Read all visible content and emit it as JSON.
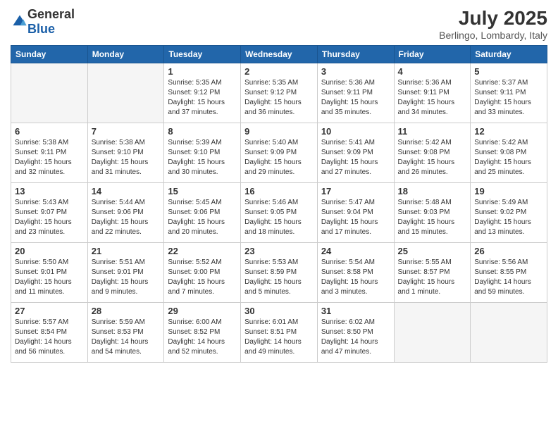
{
  "logo": {
    "general": "General",
    "blue": "Blue"
  },
  "title": {
    "month": "July 2025",
    "location": "Berlingo, Lombardy, Italy"
  },
  "weekdays": [
    "Sunday",
    "Monday",
    "Tuesday",
    "Wednesday",
    "Thursday",
    "Friday",
    "Saturday"
  ],
  "weeks": [
    [
      {
        "day": "",
        "empty": true
      },
      {
        "day": "",
        "empty": true
      },
      {
        "day": "1",
        "sunrise": "5:35 AM",
        "sunset": "9:12 PM",
        "daylight": "15 hours and 37 minutes."
      },
      {
        "day": "2",
        "sunrise": "5:35 AM",
        "sunset": "9:12 PM",
        "daylight": "15 hours and 36 minutes."
      },
      {
        "day": "3",
        "sunrise": "5:36 AM",
        "sunset": "9:11 PM",
        "daylight": "15 hours and 35 minutes."
      },
      {
        "day": "4",
        "sunrise": "5:36 AM",
        "sunset": "9:11 PM",
        "daylight": "15 hours and 34 minutes."
      },
      {
        "day": "5",
        "sunrise": "5:37 AM",
        "sunset": "9:11 PM",
        "daylight": "15 hours and 33 minutes."
      }
    ],
    [
      {
        "day": "6",
        "sunrise": "5:38 AM",
        "sunset": "9:11 PM",
        "daylight": "15 hours and 32 minutes."
      },
      {
        "day": "7",
        "sunrise": "5:38 AM",
        "sunset": "9:10 PM",
        "daylight": "15 hours and 31 minutes."
      },
      {
        "day": "8",
        "sunrise": "5:39 AM",
        "sunset": "9:10 PM",
        "daylight": "15 hours and 30 minutes."
      },
      {
        "day": "9",
        "sunrise": "5:40 AM",
        "sunset": "9:09 PM",
        "daylight": "15 hours and 29 minutes."
      },
      {
        "day": "10",
        "sunrise": "5:41 AM",
        "sunset": "9:09 PM",
        "daylight": "15 hours and 27 minutes."
      },
      {
        "day": "11",
        "sunrise": "5:42 AM",
        "sunset": "9:08 PM",
        "daylight": "15 hours and 26 minutes."
      },
      {
        "day": "12",
        "sunrise": "5:42 AM",
        "sunset": "9:08 PM",
        "daylight": "15 hours and 25 minutes."
      }
    ],
    [
      {
        "day": "13",
        "sunrise": "5:43 AM",
        "sunset": "9:07 PM",
        "daylight": "15 hours and 23 minutes."
      },
      {
        "day": "14",
        "sunrise": "5:44 AM",
        "sunset": "9:06 PM",
        "daylight": "15 hours and 22 minutes."
      },
      {
        "day": "15",
        "sunrise": "5:45 AM",
        "sunset": "9:06 PM",
        "daylight": "15 hours and 20 minutes."
      },
      {
        "day": "16",
        "sunrise": "5:46 AM",
        "sunset": "9:05 PM",
        "daylight": "15 hours and 18 minutes."
      },
      {
        "day": "17",
        "sunrise": "5:47 AM",
        "sunset": "9:04 PM",
        "daylight": "15 hours and 17 minutes."
      },
      {
        "day": "18",
        "sunrise": "5:48 AM",
        "sunset": "9:03 PM",
        "daylight": "15 hours and 15 minutes."
      },
      {
        "day": "19",
        "sunrise": "5:49 AM",
        "sunset": "9:02 PM",
        "daylight": "15 hours and 13 minutes."
      }
    ],
    [
      {
        "day": "20",
        "sunrise": "5:50 AM",
        "sunset": "9:01 PM",
        "daylight": "15 hours and 11 minutes."
      },
      {
        "day": "21",
        "sunrise": "5:51 AM",
        "sunset": "9:01 PM",
        "daylight": "15 hours and 9 minutes."
      },
      {
        "day": "22",
        "sunrise": "5:52 AM",
        "sunset": "9:00 PM",
        "daylight": "15 hours and 7 minutes."
      },
      {
        "day": "23",
        "sunrise": "5:53 AM",
        "sunset": "8:59 PM",
        "daylight": "15 hours and 5 minutes."
      },
      {
        "day": "24",
        "sunrise": "5:54 AM",
        "sunset": "8:58 PM",
        "daylight": "15 hours and 3 minutes."
      },
      {
        "day": "25",
        "sunrise": "5:55 AM",
        "sunset": "8:57 PM",
        "daylight": "15 hours and 1 minute."
      },
      {
        "day": "26",
        "sunrise": "5:56 AM",
        "sunset": "8:55 PM",
        "daylight": "14 hours and 59 minutes."
      }
    ],
    [
      {
        "day": "27",
        "sunrise": "5:57 AM",
        "sunset": "8:54 PM",
        "daylight": "14 hours and 56 minutes."
      },
      {
        "day": "28",
        "sunrise": "5:59 AM",
        "sunset": "8:53 PM",
        "daylight": "14 hours and 54 minutes."
      },
      {
        "day": "29",
        "sunrise": "6:00 AM",
        "sunset": "8:52 PM",
        "daylight": "14 hours and 52 minutes."
      },
      {
        "day": "30",
        "sunrise": "6:01 AM",
        "sunset": "8:51 PM",
        "daylight": "14 hours and 49 minutes."
      },
      {
        "day": "31",
        "sunrise": "6:02 AM",
        "sunset": "8:50 PM",
        "daylight": "14 hours and 47 minutes."
      },
      {
        "day": "",
        "empty": true
      },
      {
        "day": "",
        "empty": true
      }
    ]
  ]
}
